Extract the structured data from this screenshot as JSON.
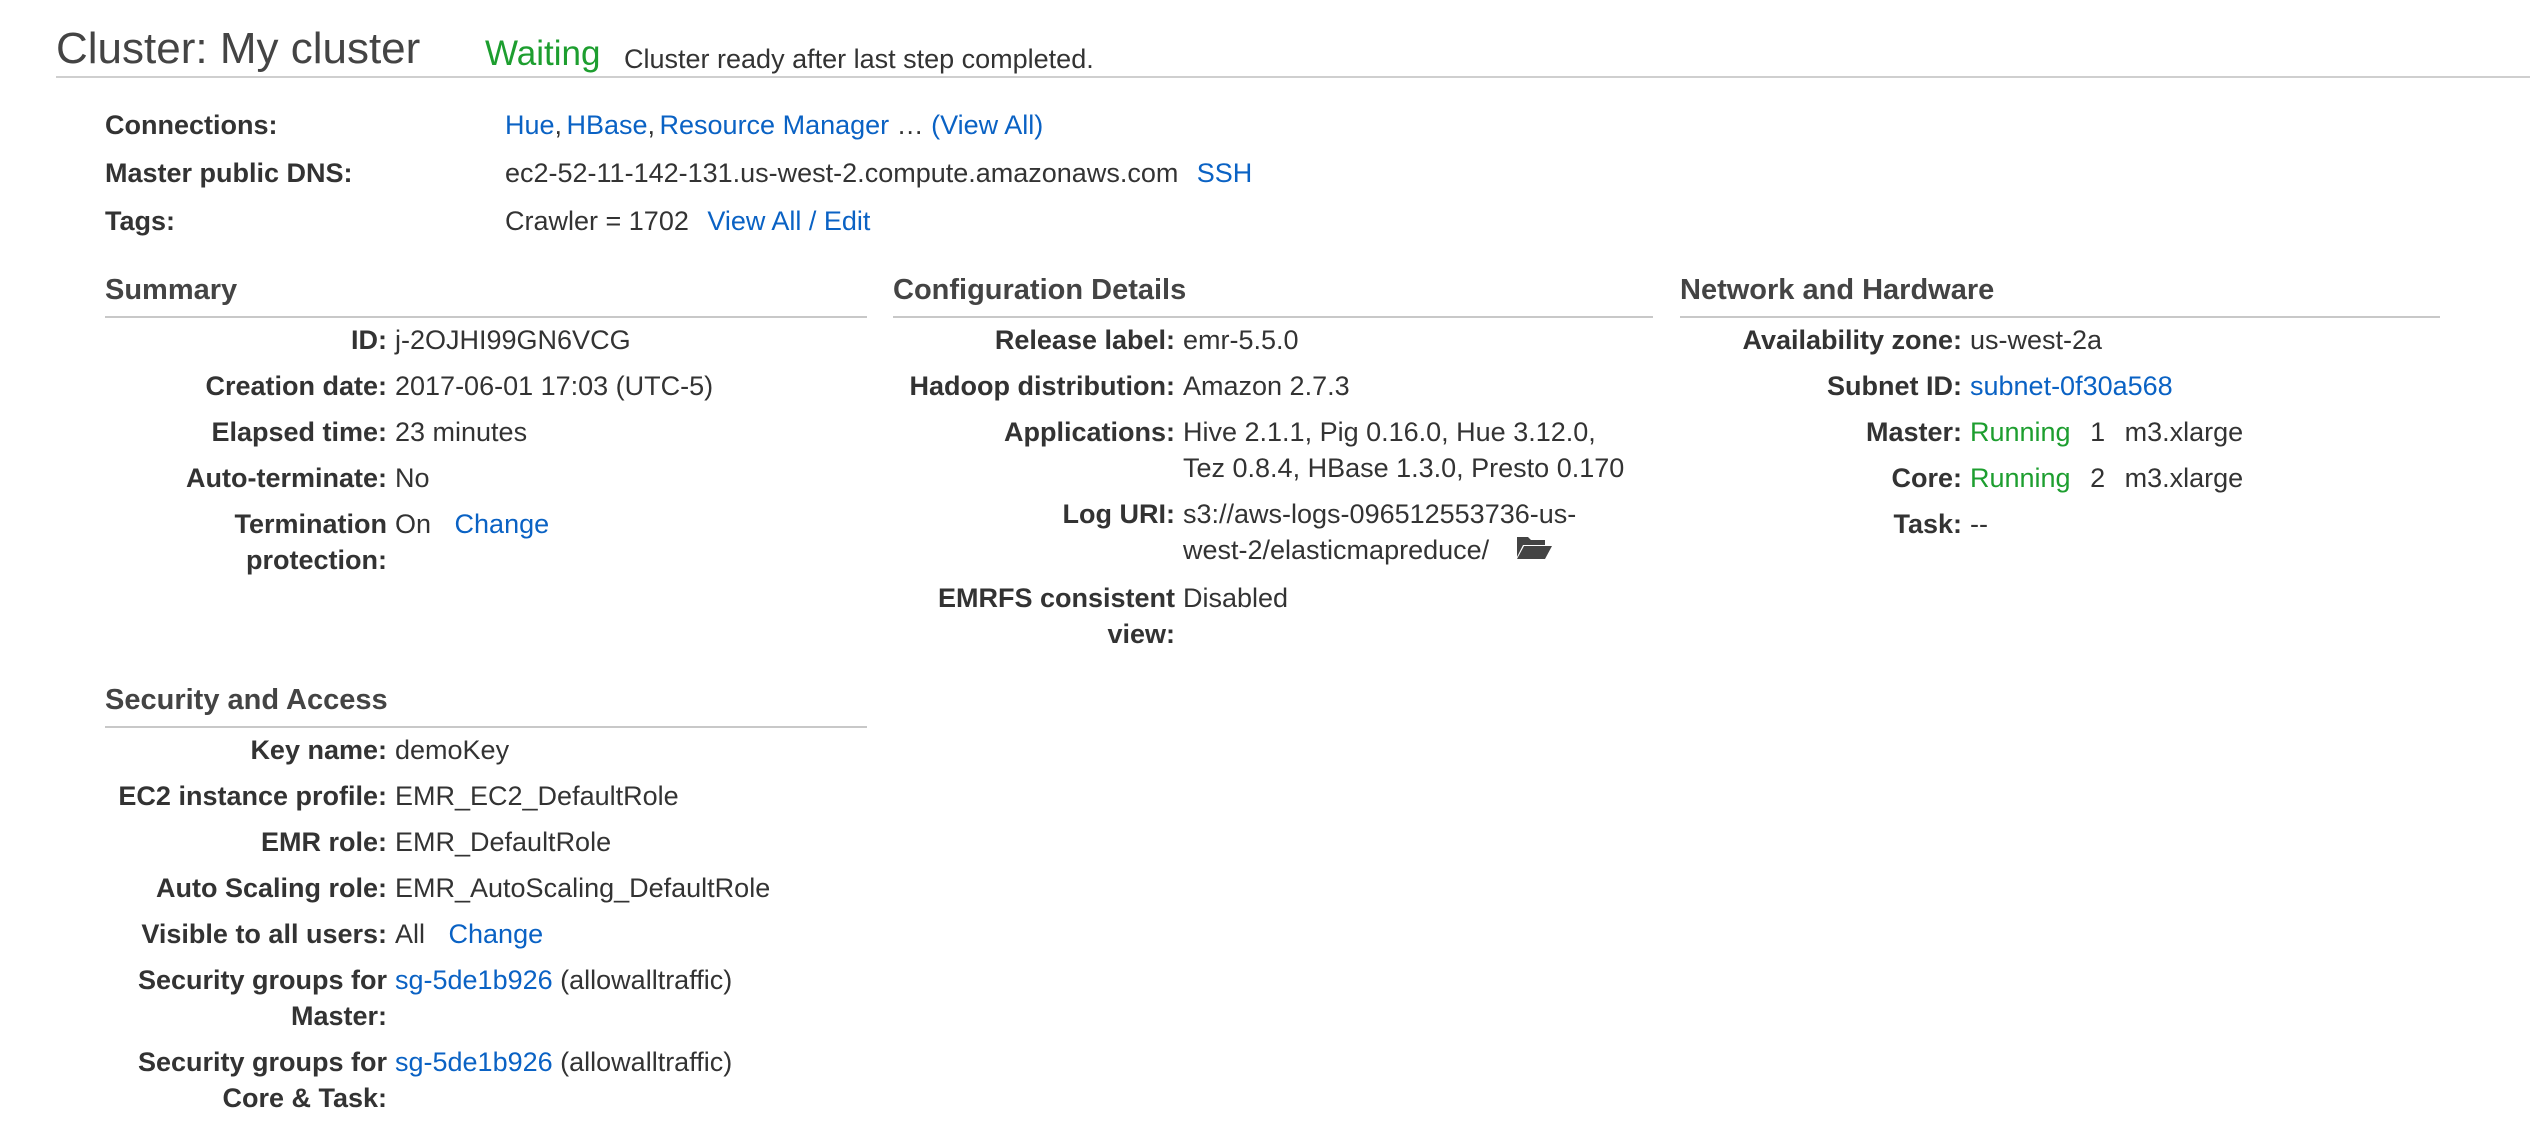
{
  "header": {
    "title": "Cluster: My cluster",
    "state": "Waiting",
    "state_message": "Cluster ready after last step completed."
  },
  "connections": {
    "label": "Connections:",
    "links": [
      "Hue",
      "HBase",
      "Resource Manager"
    ],
    "sep": ",",
    "ellipsis": " … ",
    "view_all": "(View All)"
  },
  "dns": {
    "label": "Master public DNS:",
    "value": "ec2-52-11-142-131.us-west-2.compute.amazonaws.com",
    "ssh": "SSH"
  },
  "tags": {
    "label": "Tags:",
    "value": "Crawler = 1702",
    "edit": "View All / Edit"
  },
  "summary": {
    "title": "Summary",
    "id_label": "ID:",
    "id": "j-2OJHI99GN6VCG",
    "creation_label": "Creation date:",
    "creation": "2017-06-01 17:03 (UTC-5)",
    "elapsed_label": "Elapsed time:",
    "elapsed": "23 minutes",
    "autoterm_label": "Auto-terminate:",
    "autoterm": "No",
    "termprot_label_1": "Termination",
    "termprot_label_2": "protection:",
    "termprot": "On",
    "termprot_change": "Change"
  },
  "config": {
    "title": "Configuration Details",
    "release_label": "Release label:",
    "release": "emr-5.5.0",
    "hadoop_label": "Hadoop distribution:",
    "hadoop": "Amazon 2.7.3",
    "apps_label": "Applications:",
    "apps_1": "Hive 2.1.1, Pig 0.16.0, Hue 3.12.0,",
    "apps_2": "Tez 0.8.4, HBase 1.3.0, Presto 0.170",
    "log_label": "Log URI:",
    "log_1": "s3://aws-logs-096512553736-us-",
    "log_2": "west-2/elasticmapreduce/",
    "emrfs_label_1": "EMRFS consistent",
    "emrfs_label_2": "view:",
    "emrfs": "Disabled"
  },
  "network": {
    "title": "Network and Hardware",
    "az_label": "Availability zone:",
    "az": "us-west-2a",
    "subnet_label": "Subnet ID:",
    "subnet": "subnet-0f30a568",
    "master_label": "Master:",
    "master_state": "Running",
    "master_count": "1",
    "master_type": "m3.xlarge",
    "core_label": "Core:",
    "core_state": "Running",
    "core_count": "2",
    "core_type": "m3.xlarge",
    "task_label": "Task:",
    "task": "--"
  },
  "security": {
    "title": "Security and Access",
    "key_label": "Key name:",
    "key": "demoKey",
    "ec2_label": "EC2 instance profile:",
    "ec2": "EMR_EC2_DefaultRole",
    "emr_role_label": "EMR role:",
    "emr_role": "EMR_DefaultRole",
    "as_role_label": "Auto Scaling role:",
    "as_role": "EMR_AutoScaling_DefaultRole",
    "visible_label": "Visible to all users:",
    "visible": "All",
    "visible_change": "Change",
    "sg_master_label_1": "Security groups for",
    "sg_master_label_2": "Master:",
    "sg_master_link": "sg-5de1b926",
    "sg_master_name": "(allowalltraffic)",
    "sg_core_label_1": "Security groups for",
    "sg_core_label_2": "Core & Task:",
    "sg_core_link": "sg-5de1b926",
    "sg_core_name": "(allowalltraffic)"
  },
  "colors": {
    "accent_link": "#0a62c4",
    "running": "#1d9e2f"
  },
  "icons": {
    "log_folder": "folder-open-icon"
  }
}
